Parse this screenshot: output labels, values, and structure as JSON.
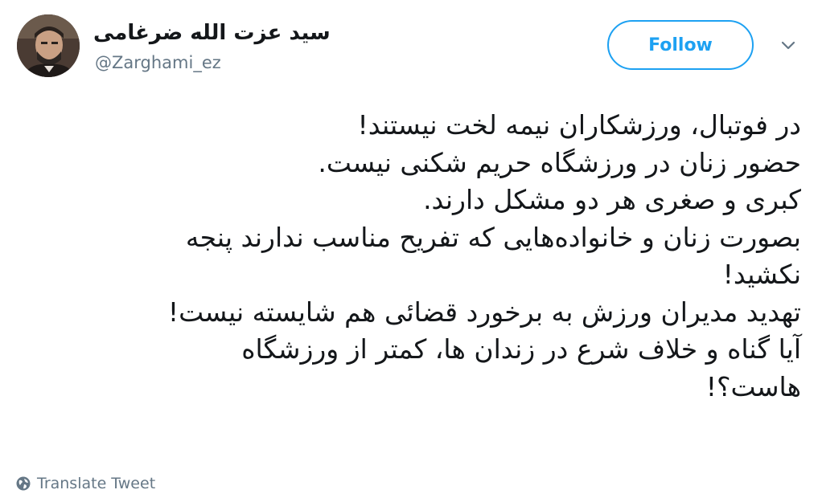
{
  "header": {
    "display_name": "سید عزت الله ضرغامی",
    "handle": "@Zarghami_ez",
    "follow_label": "Follow",
    "avatar_icon": "profile-photo",
    "caret_icon": "chevron-down-icon"
  },
  "tweet": {
    "lines": [
      "در فوتبال، ورزشکاران نیمه لخت نیستند!",
      "حضور زنان در ورزشگاه حریم شکنی نیست.",
      "کبری و صغری هر دو مشکل دارند.",
      "بصورت زنان و خانواده‌هایی که تفریح مناسب ندارند پنجه",
      "نکشید!",
      "تهدید مدیران ورزش به برخورد قضائی هم شایسته نیست!",
      "آیا گناه و خلاف شرع در زندان ها، کمتر از ورزشگاه",
      "هاست؟!"
    ]
  },
  "footer": {
    "translate_label": "Translate Tweet",
    "globe_icon": "globe-icon"
  },
  "colors": {
    "accent": "#1da1f2",
    "secondary_text": "#657786",
    "primary_text": "#14171a"
  }
}
